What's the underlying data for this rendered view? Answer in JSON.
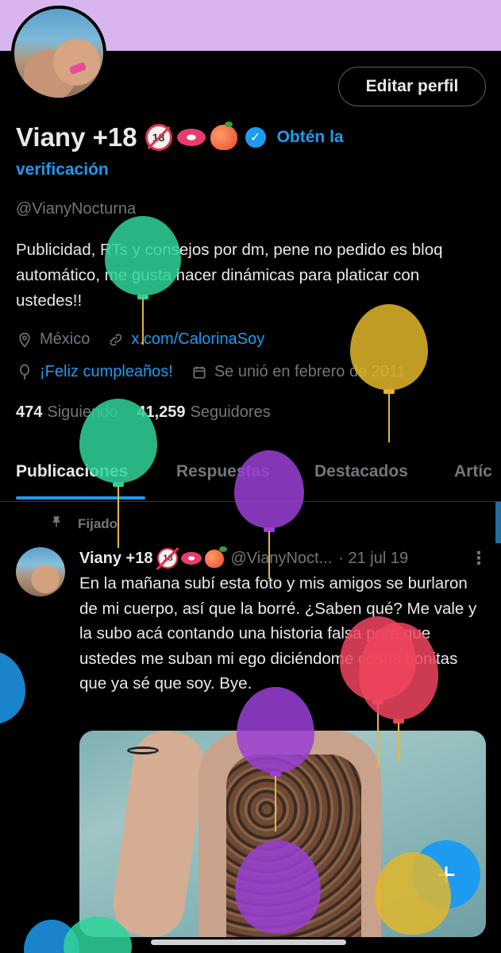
{
  "profile": {
    "display_name": "Viany +18",
    "badge_18_text": "18",
    "verify_text_line1": "Obtén la",
    "verify_text_line2": "verificación",
    "handle": "@VianyNocturna",
    "bio": "Publicidad, RTs y consejos por dm, pene no pedido es bloq automático, me gusta hacer dinámicas para platicar con ustedes!!",
    "location": "México",
    "website": "x.com/CalorinaSoy",
    "birthday": "¡Feliz cumpleaños!",
    "joined": "Se unió en febrero de 2011",
    "following_count": "474",
    "following_label": "Siguiendo",
    "followers_count": "41,259",
    "followers_label": "Seguidores"
  },
  "buttons": {
    "edit_profile": "Editar perfil",
    "compose": "+"
  },
  "tabs": [
    {
      "label": "Publicaciones",
      "active": true
    },
    {
      "label": "Respuestas",
      "active": false
    },
    {
      "label": "Destacados",
      "active": false
    },
    {
      "label": "Artíc",
      "active": false
    }
  ],
  "post": {
    "pinned_label": "Fijado",
    "author_name": "Viany +18",
    "author_handle": "@VianyNoct...",
    "date": "· 21 jul 19",
    "text": "En la mañana subí esta foto y mis amigos se burlaron de mi cuerpo, así que la borré. ¿Saben qué? Me vale y la subo acá contando una historia falsa para que ustedes me suban mi ego diciéndome cosas bonitas que ya sé que soy. Bye."
  },
  "icons": [
    "verified-icon",
    "location-pin-icon",
    "link-icon",
    "balloon-icon",
    "calendar-icon",
    "pin-icon",
    "more-icon",
    "plus-icon"
  ],
  "colors": {
    "background": "#000000",
    "banner": "#d9b5ee",
    "accent": "#1d9bf0",
    "text_primary": "#e7e9ea",
    "text_secondary": "#71767b"
  }
}
